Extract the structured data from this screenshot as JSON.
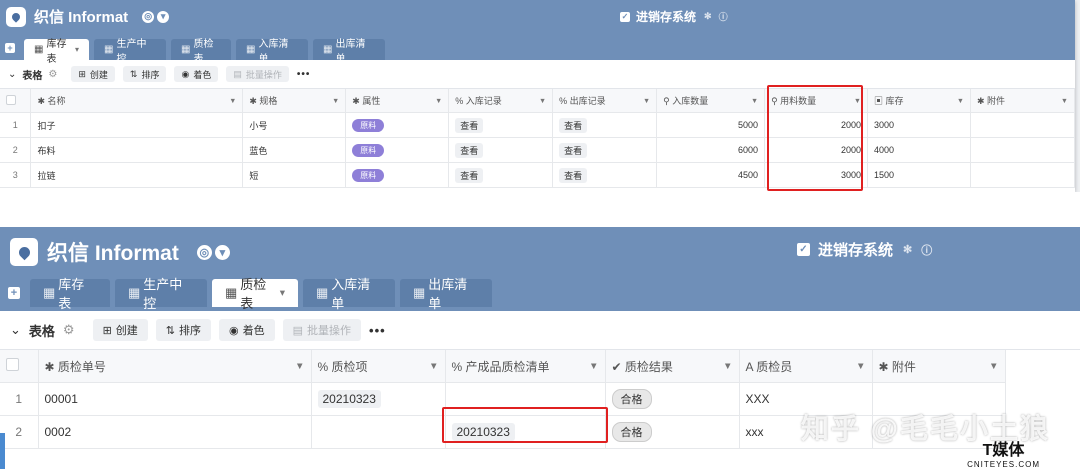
{
  "app": {
    "brand": "织信 Informat",
    "system_name": "进销存系统"
  },
  "colors": {
    "header_bg": "#6f8fb8",
    "tag_purple": "#8e7fd8",
    "highlight": "#e02020"
  },
  "toolbar": {
    "view_label": "表格",
    "create": "创建",
    "sort": "排序",
    "color": "着色",
    "batch": "批量操作",
    "more": "•••"
  },
  "panel1": {
    "tabs": [
      {
        "label": "库存表",
        "active": true
      },
      {
        "label": "生产中控",
        "active": false
      },
      {
        "label": "质检表",
        "active": false
      },
      {
        "label": "入库清单",
        "active": false
      },
      {
        "label": "出库清单",
        "active": false
      }
    ],
    "columns": [
      "名称",
      "规格",
      "属性",
      "入库记录",
      "出库记录",
      "入库数量",
      "用料数量",
      "库存",
      "附件"
    ],
    "rows": [
      {
        "no": "1",
        "name": "扣子",
        "spec": "小号",
        "attr": "原料",
        "in_rec": "查看",
        "out_rec": "查看",
        "in_qty": "5000",
        "use_qty": "2000",
        "stock": "3000"
      },
      {
        "no": "2",
        "name": "布料",
        "spec": "蓝色",
        "attr": "原料",
        "in_rec": "查看",
        "out_rec": "查看",
        "in_qty": "6000",
        "use_qty": "2000",
        "stock": "4000"
      },
      {
        "no": "3",
        "name": "拉链",
        "spec": "短",
        "attr": "原料",
        "in_rec": "查看",
        "out_rec": "查看",
        "in_qty": "4500",
        "use_qty": "3000",
        "stock": "1500"
      }
    ]
  },
  "panel2": {
    "tabs": [
      {
        "label": "库存表",
        "active": false
      },
      {
        "label": "生产中控",
        "active": false
      },
      {
        "label": "质检表",
        "active": true
      },
      {
        "label": "入库清单",
        "active": false
      },
      {
        "label": "出库清单",
        "active": false
      }
    ],
    "columns": [
      "质检单号",
      "质检项",
      "产成品质检清单",
      "质检结果",
      "质检员",
      "附件"
    ],
    "rows": [
      {
        "no": "1",
        "id": "00001",
        "item": "20210323",
        "list": "",
        "result": "合格",
        "inspector": "XXX"
      },
      {
        "no": "2",
        "id": "0002",
        "item": "",
        "list": "20210323",
        "result": "合格",
        "inspector": "xxx"
      }
    ]
  },
  "watermark": {
    "zhihu": "知乎 @毛毛小土狼",
    "badge_cn": "T媒体",
    "badge_en": "CNITEYES.COM"
  }
}
